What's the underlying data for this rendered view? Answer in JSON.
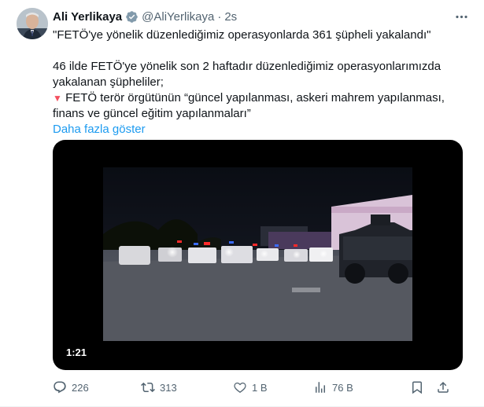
{
  "tweet": {
    "author_name": "Ali Yerlikaya",
    "handle": "@AliYerlikaya",
    "separator": "·",
    "time": "2s",
    "line1": "\"FETÖ'ye yönelik düzenlediğimiz operasyonlarda 361 şüpheli yakalandı\"",
    "line2": "46 ilde FETÖ'ye yönelik son 2 haftadır düzenlediğimiz operasyonlarımızda yakalanan şüpheliler;",
    "bullet_icon": "▼",
    "line3": "FETÖ terör örgütünün “güncel yapılanması, askeri mahrem yapılanması, finans ve güncel eğitim yapılanmaları”",
    "show_more": "Daha fazla göster",
    "video_duration": "1:21"
  },
  "actions": {
    "replies": "226",
    "reposts": "313",
    "likes": "1 B",
    "views": "76 B"
  },
  "icons": {
    "verified": "verified-badge-icon",
    "more": "more-horizontal-icon",
    "reply": "reply-icon",
    "repost": "repost-icon",
    "like": "heart-icon",
    "views": "views-icon",
    "bookmark": "bookmark-icon",
    "share": "share-icon"
  },
  "colors": {
    "text": "#0f1419",
    "muted": "#536471",
    "link": "#1d9bf0",
    "verified": "#829aab",
    "bullet": "#f4505f"
  }
}
